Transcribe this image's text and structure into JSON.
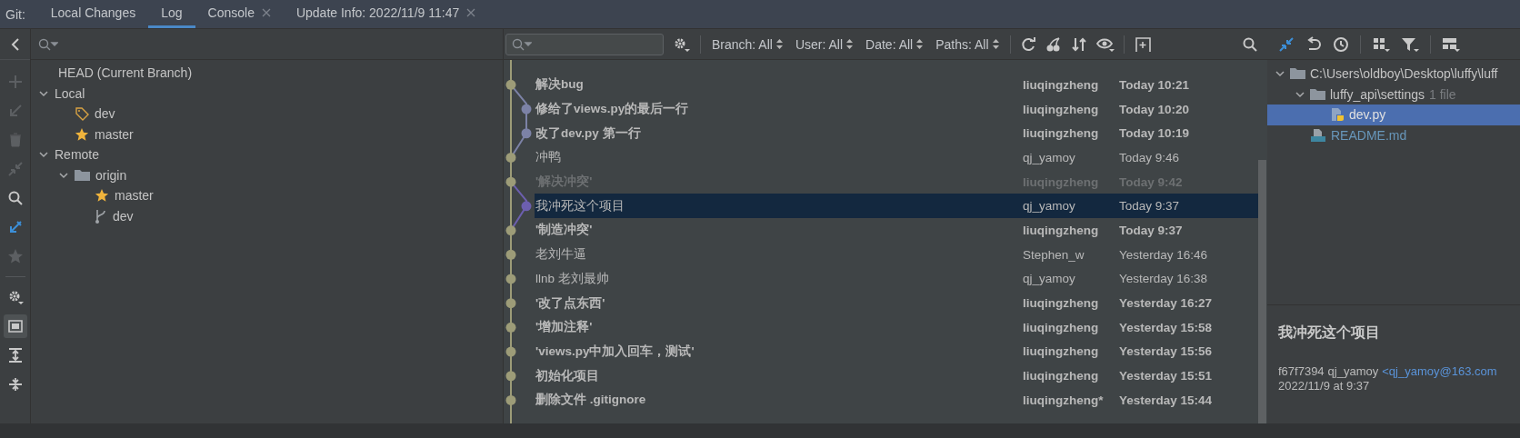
{
  "tool_window": {
    "label": "Git:"
  },
  "tabs": [
    {
      "label": "Local Changes",
      "selected": false,
      "closable": false
    },
    {
      "label": "Log",
      "selected": true,
      "closable": false
    },
    {
      "label": "Console",
      "selected": false,
      "closable": true
    },
    {
      "label": "Update Info: 2022/11/9 11:47",
      "selected": false,
      "closable": true
    }
  ],
  "left_toolbar": [
    {
      "disabled": true,
      "selected": false
    },
    {
      "disabled": true,
      "selected": false
    },
    {
      "disabled": true,
      "selected": false
    },
    {
      "disabled": true,
      "selected": false
    },
    {
      "disabled": false,
      "selected": false
    },
    {
      "disabled": false,
      "selected": false
    },
    {
      "disabled": true,
      "selected": false
    },
    {
      "disabled": false,
      "selected": false
    },
    {
      "disabled": false,
      "selected": true
    },
    {
      "disabled": false,
      "selected": false
    },
    {
      "disabled": false,
      "selected": false
    }
  ],
  "branches": [
    {
      "label": "HEAD (Current Branch)",
      "kind": "head"
    },
    {
      "label": "Local",
      "kind": "group",
      "expanded": true,
      "children": [
        {
          "label": "dev",
          "kind": "tag"
        },
        {
          "label": "master",
          "kind": "star"
        }
      ]
    },
    {
      "label": "Remote",
      "kind": "group",
      "expanded": true,
      "children": [
        {
          "label": "origin",
          "kind": "folder",
          "expanded": true,
          "children": [
            {
              "label": "master",
              "kind": "star"
            },
            {
              "label": "dev",
              "kind": "branch"
            }
          ]
        }
      ]
    }
  ],
  "log_filters": [
    {
      "label": "Branch: All"
    },
    {
      "label": "User: All"
    },
    {
      "label": "Date: All"
    },
    {
      "label": "Paths: All"
    }
  ],
  "commits": [
    {
      "subject": "解决bug",
      "author": "liuqingzheng",
      "date": "Today 10:21",
      "bold": true,
      "dimmed": false,
      "selected": false,
      "kind": "main",
      "color": "#9d9c78"
    },
    {
      "subject": "修给了views.py的最后一行",
      "author": "liuqingzheng",
      "date": "Today 10:20",
      "bold": true,
      "dimmed": false,
      "selected": false,
      "kind": "branch",
      "color": "#7c82a6"
    },
    {
      "subject": "改了dev.py 第一行",
      "author": "liuqingzheng",
      "date": "Today 10:19",
      "bold": true,
      "dimmed": false,
      "selected": false,
      "kind": "branch",
      "color": "#7c82a6"
    },
    {
      "subject": "冲鸭",
      "author": "qj_yamoy",
      "date": "Today 9:46",
      "bold": false,
      "dimmed": false,
      "selected": false,
      "kind": "main",
      "color": "#9d9c78"
    },
    {
      "subject": "'解决冲突'",
      "author": "liuqingzheng",
      "date": "Today 9:42",
      "bold": true,
      "dimmed": true,
      "selected": false,
      "kind": "main",
      "color": "#9d9c78"
    },
    {
      "subject": "我冲死这个项目",
      "author": "qj_yamoy",
      "date": "Today 9:37",
      "bold": false,
      "dimmed": false,
      "selected": true,
      "kind": "branch",
      "color": "#6c5fae"
    },
    {
      "subject": "'制造冲突'",
      "author": "liuqingzheng",
      "date": "Today 9:37",
      "bold": true,
      "dimmed": false,
      "selected": false,
      "kind": "main",
      "color": "#9d9c78"
    },
    {
      "subject": "老刘牛逼",
      "author": "Stephen_w",
      "date": "Yesterday 16:46",
      "bold": false,
      "dimmed": false,
      "selected": false,
      "kind": "main",
      "color": "#9d9c78"
    },
    {
      "subject": "llnb 老刘最帅",
      "author": "qj_yamoy",
      "date": "Yesterday 16:38",
      "bold": false,
      "dimmed": false,
      "selected": false,
      "kind": "main",
      "color": "#9d9c78"
    },
    {
      "subject": "'改了点东西'",
      "author": "liuqingzheng",
      "date": "Yesterday 16:27",
      "bold": true,
      "dimmed": false,
      "selected": false,
      "kind": "main",
      "color": "#9d9c78"
    },
    {
      "subject": "'增加注释'",
      "author": "liuqingzheng",
      "date": "Yesterday 15:58",
      "bold": true,
      "dimmed": false,
      "selected": false,
      "kind": "main",
      "color": "#9d9c78"
    },
    {
      "subject": "'views.py中加入回车，测试'",
      "author": "liuqingzheng",
      "date": "Yesterday 15:56",
      "bold": true,
      "dimmed": false,
      "selected": false,
      "kind": "main",
      "color": "#9d9c78"
    },
    {
      "subject": "初始化项目",
      "author": "liuqingzheng",
      "date": "Yesterday 15:51",
      "bold": true,
      "dimmed": false,
      "selected": false,
      "kind": "main",
      "color": "#9d9c78"
    },
    {
      "subject": "删除文件 .gitignore",
      "author": "liuqingzheng*",
      "date": "Yesterday 15:44",
      "bold": true,
      "dimmed": false,
      "selected": false,
      "kind": "main",
      "color": "#9d9c78"
    }
  ],
  "changed_files": [
    {
      "label": "C:\\Users\\oldboy\\Desktop\\luffy\\luff",
      "kind": "folder",
      "expanded": true,
      "children": [
        {
          "label": "luffy_api\\settings",
          "count": "1 file",
          "kind": "folder",
          "expanded": true,
          "children": [
            {
              "label": "dev.py",
              "kind": "python",
              "selected": true,
              "modified": false
            }
          ]
        },
        {
          "label": "README.md",
          "kind": "markdown",
          "selected": false,
          "modified": true
        }
      ]
    }
  ],
  "commit_details": {
    "subject": "我冲死这个项目",
    "hash": "f67f7394",
    "author": "qj_yamoy",
    "email": "<qj_yamoy@163.com",
    "date": "2022/11/9 at 9:37"
  }
}
